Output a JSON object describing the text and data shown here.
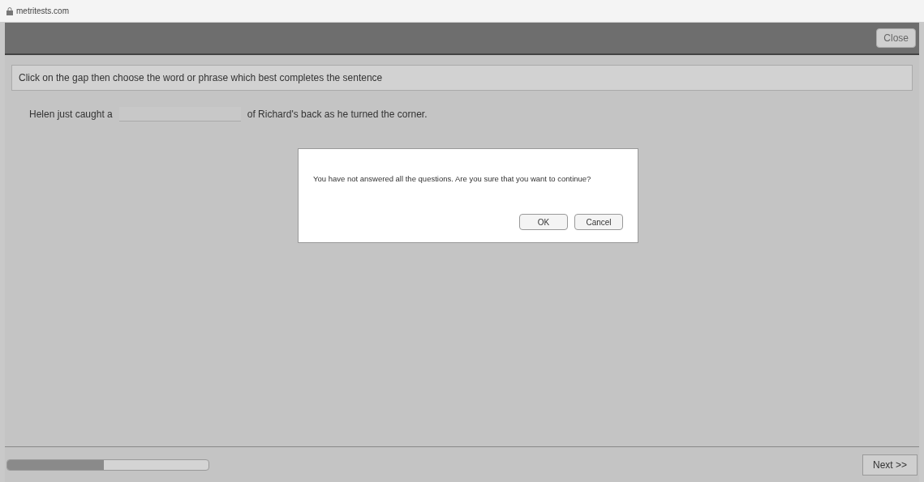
{
  "address_bar": {
    "domain": "metritests.com"
  },
  "header": {
    "close_button": "Close"
  },
  "instruction": "Click on the gap then choose the word or phrase which best completes the sentence",
  "question": {
    "before_gap": "Helen just caught a",
    "after_gap": "of Richard's back as he turned the corner."
  },
  "dialog": {
    "message": "You have not answered all the questions. Are you sure that you want to continue?",
    "buttons": [
      "OK",
      "Cancel"
    ]
  },
  "footer": {
    "progress": {
      "level": 0.48
    },
    "next_button": "Next >>"
  }
}
